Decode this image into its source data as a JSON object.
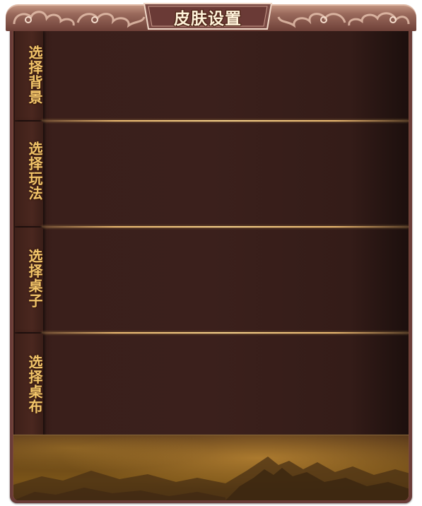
{
  "window": {
    "title": "皮肤设置"
  },
  "sections": [
    {
      "label": "选择背景"
    },
    {
      "label": "选择玩法"
    },
    {
      "label": "选择桌子"
    },
    {
      "label": "选择桌布"
    }
  ],
  "colors": {
    "panel_bg": "#3b201c",
    "accent_gold": "#f2c56a",
    "frame": "#6a3c38"
  }
}
